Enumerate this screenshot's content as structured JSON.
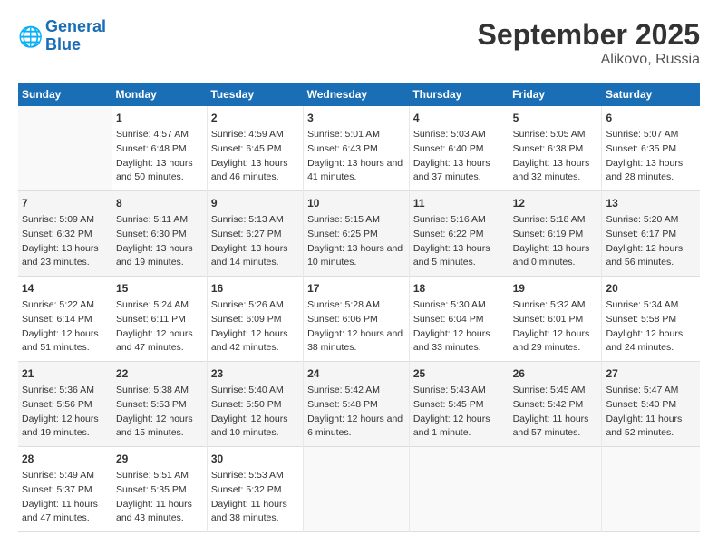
{
  "header": {
    "logo_general": "General",
    "logo_blue": "Blue",
    "month": "September 2025",
    "location": "Alikovo, Russia"
  },
  "days_of_week": [
    "Sunday",
    "Monday",
    "Tuesday",
    "Wednesday",
    "Thursday",
    "Friday",
    "Saturday"
  ],
  "weeks": [
    [
      {
        "num": "",
        "sunrise": "",
        "sunset": "",
        "daylight": ""
      },
      {
        "num": "1",
        "sunrise": "Sunrise: 4:57 AM",
        "sunset": "Sunset: 6:48 PM",
        "daylight": "Daylight: 13 hours and 50 minutes."
      },
      {
        "num": "2",
        "sunrise": "Sunrise: 4:59 AM",
        "sunset": "Sunset: 6:45 PM",
        "daylight": "Daylight: 13 hours and 46 minutes."
      },
      {
        "num": "3",
        "sunrise": "Sunrise: 5:01 AM",
        "sunset": "Sunset: 6:43 PM",
        "daylight": "Daylight: 13 hours and 41 minutes."
      },
      {
        "num": "4",
        "sunrise": "Sunrise: 5:03 AM",
        "sunset": "Sunset: 6:40 PM",
        "daylight": "Daylight: 13 hours and 37 minutes."
      },
      {
        "num": "5",
        "sunrise": "Sunrise: 5:05 AM",
        "sunset": "Sunset: 6:38 PM",
        "daylight": "Daylight: 13 hours and 32 minutes."
      },
      {
        "num": "6",
        "sunrise": "Sunrise: 5:07 AM",
        "sunset": "Sunset: 6:35 PM",
        "daylight": "Daylight: 13 hours and 28 minutes."
      }
    ],
    [
      {
        "num": "7",
        "sunrise": "Sunrise: 5:09 AM",
        "sunset": "Sunset: 6:32 PM",
        "daylight": "Daylight: 13 hours and 23 minutes."
      },
      {
        "num": "8",
        "sunrise": "Sunrise: 5:11 AM",
        "sunset": "Sunset: 6:30 PM",
        "daylight": "Daylight: 13 hours and 19 minutes."
      },
      {
        "num": "9",
        "sunrise": "Sunrise: 5:13 AM",
        "sunset": "Sunset: 6:27 PM",
        "daylight": "Daylight: 13 hours and 14 minutes."
      },
      {
        "num": "10",
        "sunrise": "Sunrise: 5:15 AM",
        "sunset": "Sunset: 6:25 PM",
        "daylight": "Daylight: 13 hours and 10 minutes."
      },
      {
        "num": "11",
        "sunrise": "Sunrise: 5:16 AM",
        "sunset": "Sunset: 6:22 PM",
        "daylight": "Daylight: 13 hours and 5 minutes."
      },
      {
        "num": "12",
        "sunrise": "Sunrise: 5:18 AM",
        "sunset": "Sunset: 6:19 PM",
        "daylight": "Daylight: 13 hours and 0 minutes."
      },
      {
        "num": "13",
        "sunrise": "Sunrise: 5:20 AM",
        "sunset": "Sunset: 6:17 PM",
        "daylight": "Daylight: 12 hours and 56 minutes."
      }
    ],
    [
      {
        "num": "14",
        "sunrise": "Sunrise: 5:22 AM",
        "sunset": "Sunset: 6:14 PM",
        "daylight": "Daylight: 12 hours and 51 minutes."
      },
      {
        "num": "15",
        "sunrise": "Sunrise: 5:24 AM",
        "sunset": "Sunset: 6:11 PM",
        "daylight": "Daylight: 12 hours and 47 minutes."
      },
      {
        "num": "16",
        "sunrise": "Sunrise: 5:26 AM",
        "sunset": "Sunset: 6:09 PM",
        "daylight": "Daylight: 12 hours and 42 minutes."
      },
      {
        "num": "17",
        "sunrise": "Sunrise: 5:28 AM",
        "sunset": "Sunset: 6:06 PM",
        "daylight": "Daylight: 12 hours and 38 minutes."
      },
      {
        "num": "18",
        "sunrise": "Sunrise: 5:30 AM",
        "sunset": "Sunset: 6:04 PM",
        "daylight": "Daylight: 12 hours and 33 minutes."
      },
      {
        "num": "19",
        "sunrise": "Sunrise: 5:32 AM",
        "sunset": "Sunset: 6:01 PM",
        "daylight": "Daylight: 12 hours and 29 minutes."
      },
      {
        "num": "20",
        "sunrise": "Sunrise: 5:34 AM",
        "sunset": "Sunset: 5:58 PM",
        "daylight": "Daylight: 12 hours and 24 minutes."
      }
    ],
    [
      {
        "num": "21",
        "sunrise": "Sunrise: 5:36 AM",
        "sunset": "Sunset: 5:56 PM",
        "daylight": "Daylight: 12 hours and 19 minutes."
      },
      {
        "num": "22",
        "sunrise": "Sunrise: 5:38 AM",
        "sunset": "Sunset: 5:53 PM",
        "daylight": "Daylight: 12 hours and 15 minutes."
      },
      {
        "num": "23",
        "sunrise": "Sunrise: 5:40 AM",
        "sunset": "Sunset: 5:50 PM",
        "daylight": "Daylight: 12 hours and 10 minutes."
      },
      {
        "num": "24",
        "sunrise": "Sunrise: 5:42 AM",
        "sunset": "Sunset: 5:48 PM",
        "daylight": "Daylight: 12 hours and 6 minutes."
      },
      {
        "num": "25",
        "sunrise": "Sunrise: 5:43 AM",
        "sunset": "Sunset: 5:45 PM",
        "daylight": "Daylight: 12 hours and 1 minute."
      },
      {
        "num": "26",
        "sunrise": "Sunrise: 5:45 AM",
        "sunset": "Sunset: 5:42 PM",
        "daylight": "Daylight: 11 hours and 57 minutes."
      },
      {
        "num": "27",
        "sunrise": "Sunrise: 5:47 AM",
        "sunset": "Sunset: 5:40 PM",
        "daylight": "Daylight: 11 hours and 52 minutes."
      }
    ],
    [
      {
        "num": "28",
        "sunrise": "Sunrise: 5:49 AM",
        "sunset": "Sunset: 5:37 PM",
        "daylight": "Daylight: 11 hours and 47 minutes."
      },
      {
        "num": "29",
        "sunrise": "Sunrise: 5:51 AM",
        "sunset": "Sunset: 5:35 PM",
        "daylight": "Daylight: 11 hours and 43 minutes."
      },
      {
        "num": "30",
        "sunrise": "Sunrise: 5:53 AM",
        "sunset": "Sunset: 5:32 PM",
        "daylight": "Daylight: 11 hours and 38 minutes."
      },
      {
        "num": "",
        "sunrise": "",
        "sunset": "",
        "daylight": ""
      },
      {
        "num": "",
        "sunrise": "",
        "sunset": "",
        "daylight": ""
      },
      {
        "num": "",
        "sunrise": "",
        "sunset": "",
        "daylight": ""
      },
      {
        "num": "",
        "sunrise": "",
        "sunset": "",
        "daylight": ""
      }
    ]
  ]
}
